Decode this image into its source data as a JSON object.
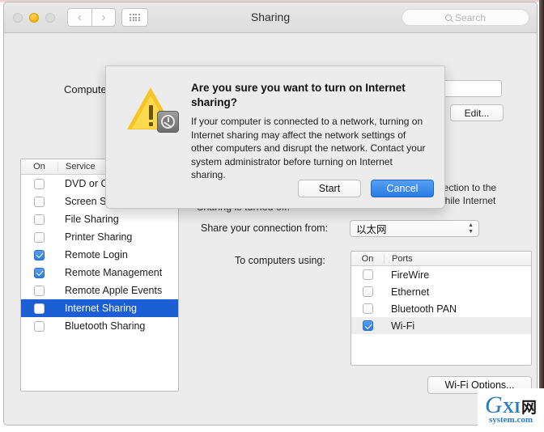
{
  "window": {
    "title": "Sharing",
    "traffic_lights": [
      "close",
      "minimize",
      "zoom"
    ],
    "nav_back": "‹",
    "nav_forward": "›",
    "grid_button": "show-all-grid"
  },
  "search": {
    "placeholder": "Search",
    "icon": "search-icon"
  },
  "computer_name": {
    "label": "Computer N",
    "field_value": "",
    "edit_button": "Edit..."
  },
  "services_table": {
    "columns": [
      "On",
      "Service"
    ],
    "rows": [
      {
        "name": "DVD or CD",
        "checked": false,
        "selected": false
      },
      {
        "name": "Screen Sh",
        "checked": false,
        "selected": false
      },
      {
        "name": "File Sharing",
        "checked": false,
        "selected": false
      },
      {
        "name": "Printer Sharing",
        "checked": false,
        "selected": false
      },
      {
        "name": "Remote Login",
        "checked": true,
        "selected": false
      },
      {
        "name": "Remote Management",
        "checked": true,
        "selected": false
      },
      {
        "name": "Remote Apple Events",
        "checked": false,
        "selected": false
      },
      {
        "name": "Internet Sharing",
        "checked": false,
        "selected": true
      },
      {
        "name": "Bluetooth Sharing",
        "checked": false,
        "selected": false
      }
    ]
  },
  "detail": {
    "status_text": "Sharing is turned off.",
    "description_tail": "nection to the\nwhile Internet",
    "share_from_label": "Share your connection from:",
    "share_from_value": "以太网",
    "to_computers_label": "To computers using:",
    "wifi_options_button": "Wi-Fi Options..."
  },
  "ports_table": {
    "columns": [
      "On",
      "Ports"
    ],
    "rows": [
      {
        "name": "FireWire",
        "checked": false,
        "highlight": false
      },
      {
        "name": "Ethernet",
        "checked": false,
        "highlight": false
      },
      {
        "name": "Bluetooth PAN",
        "checked": false,
        "highlight": false
      },
      {
        "name": "Wi-Fi",
        "checked": true,
        "highlight": true
      }
    ]
  },
  "dialog": {
    "icon": "warning-triangle-with-system-preferences-badge",
    "title": "Are you sure you want to turn on Internet sharing?",
    "body": "If your computer is connected to a network, turning on Internet sharing may affect the network settings of other computers and disrupt the network. Contact your system administrator before turning on Internet sharing.",
    "start_button": "Start",
    "cancel_button": "Cancel",
    "default_button": "Cancel"
  },
  "watermark": {
    "g": "G",
    "xi": "XI",
    "cjk": "网",
    "domain": "system.com"
  },
  "colors": {
    "selection_blue": "#1c5fd4",
    "primary_button_blue": "#2a7ae4",
    "checkbox_blue": "#2f7fe0",
    "warning_yellow": "#f6c524",
    "window_gray": "#ececec"
  }
}
